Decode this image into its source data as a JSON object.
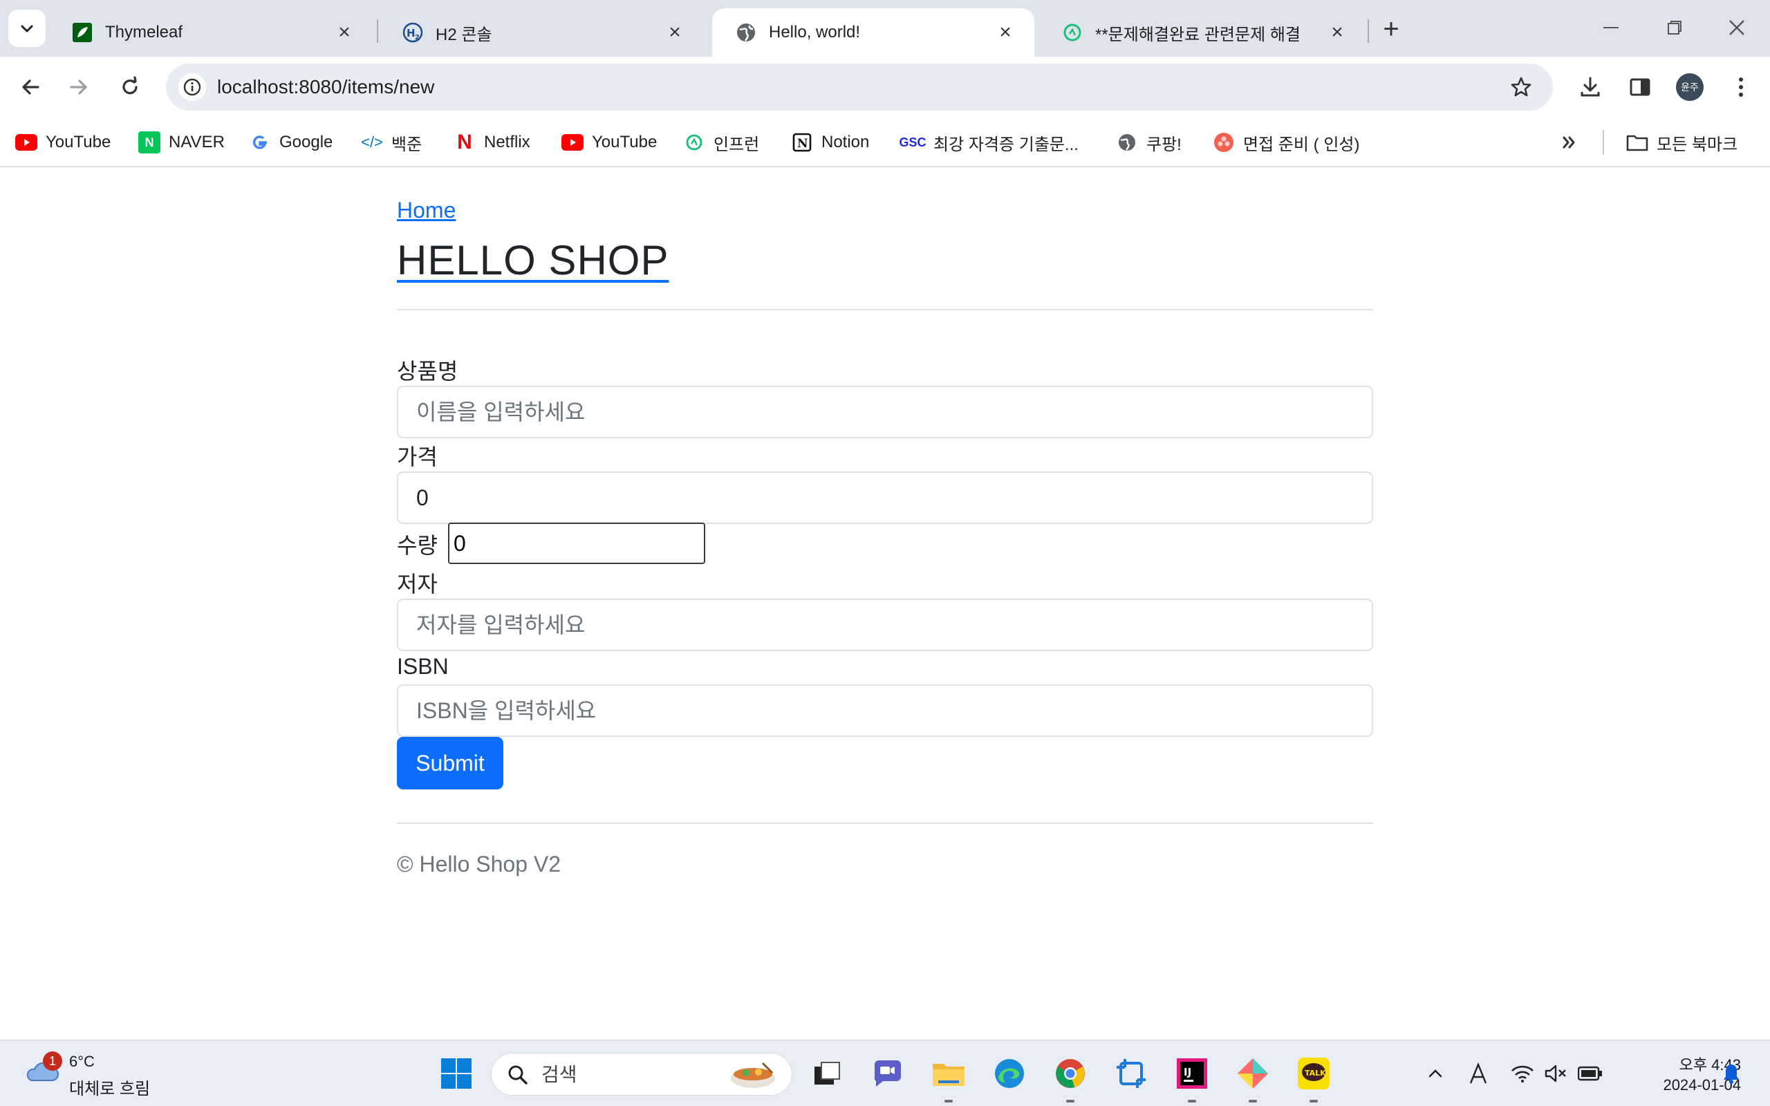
{
  "browser": {
    "tabs": [
      {
        "title": "Thymeleaf",
        "icon": "thymeleaf-leaf-icon"
      },
      {
        "title": "H2 콘솔",
        "icon": "h2-logo-icon"
      },
      {
        "title": "Hello, world!",
        "icon": "globe-icon",
        "active": true
      },
      {
        "title": "**문제해결완료 관련문제 해결",
        "icon": "inflearn-icon"
      }
    ],
    "url": "localhost:8080/items/new",
    "profile_initials": "윤주"
  },
  "bookmarks": [
    {
      "label": "YouTube",
      "icon": "youtube-icon"
    },
    {
      "label": "NAVER",
      "icon": "naver-icon"
    },
    {
      "label": "Google",
      "icon": "google-icon"
    },
    {
      "label": "백준",
      "icon": "baekjoon-icon"
    },
    {
      "label": "Netflix",
      "icon": "netflix-icon"
    },
    {
      "label": "YouTube",
      "icon": "youtube-icon"
    },
    {
      "label": "인프런",
      "icon": "inflearn-icon"
    },
    {
      "label": "Notion",
      "icon": "notion-icon"
    },
    {
      "label": "최강 자격증 기출문...",
      "icon": "gsc-icon"
    },
    {
      "label": "쿠팡!",
      "icon": "globe-icon"
    },
    {
      "label": "면접 준비 ( 인성)",
      "icon": "flower-icon"
    }
  ],
  "bookmarks_all": "모든 북마크",
  "page": {
    "home_link": "Home",
    "shop_title": "HELLO SHOP",
    "form": {
      "name_label": "상품명",
      "name_placeholder": "이름을 입력하세요",
      "price_label": "가격",
      "price_value": "0",
      "quantity_label": "수량",
      "quantity_value": "0",
      "author_label": "저자",
      "author_placeholder": "저자를 입력하세요",
      "isbn_label": "ISBN",
      "isbn_placeholder": "ISBN을 입력하세요",
      "submit_label": "Submit"
    },
    "footer": "© Hello Shop V2"
  },
  "taskbar": {
    "weather_badge": "1",
    "weather_temp": "6°C",
    "weather_desc": "대체로 흐림",
    "search_placeholder": "검색",
    "time": "오후 4:43",
    "date": "2024-01-04"
  }
}
